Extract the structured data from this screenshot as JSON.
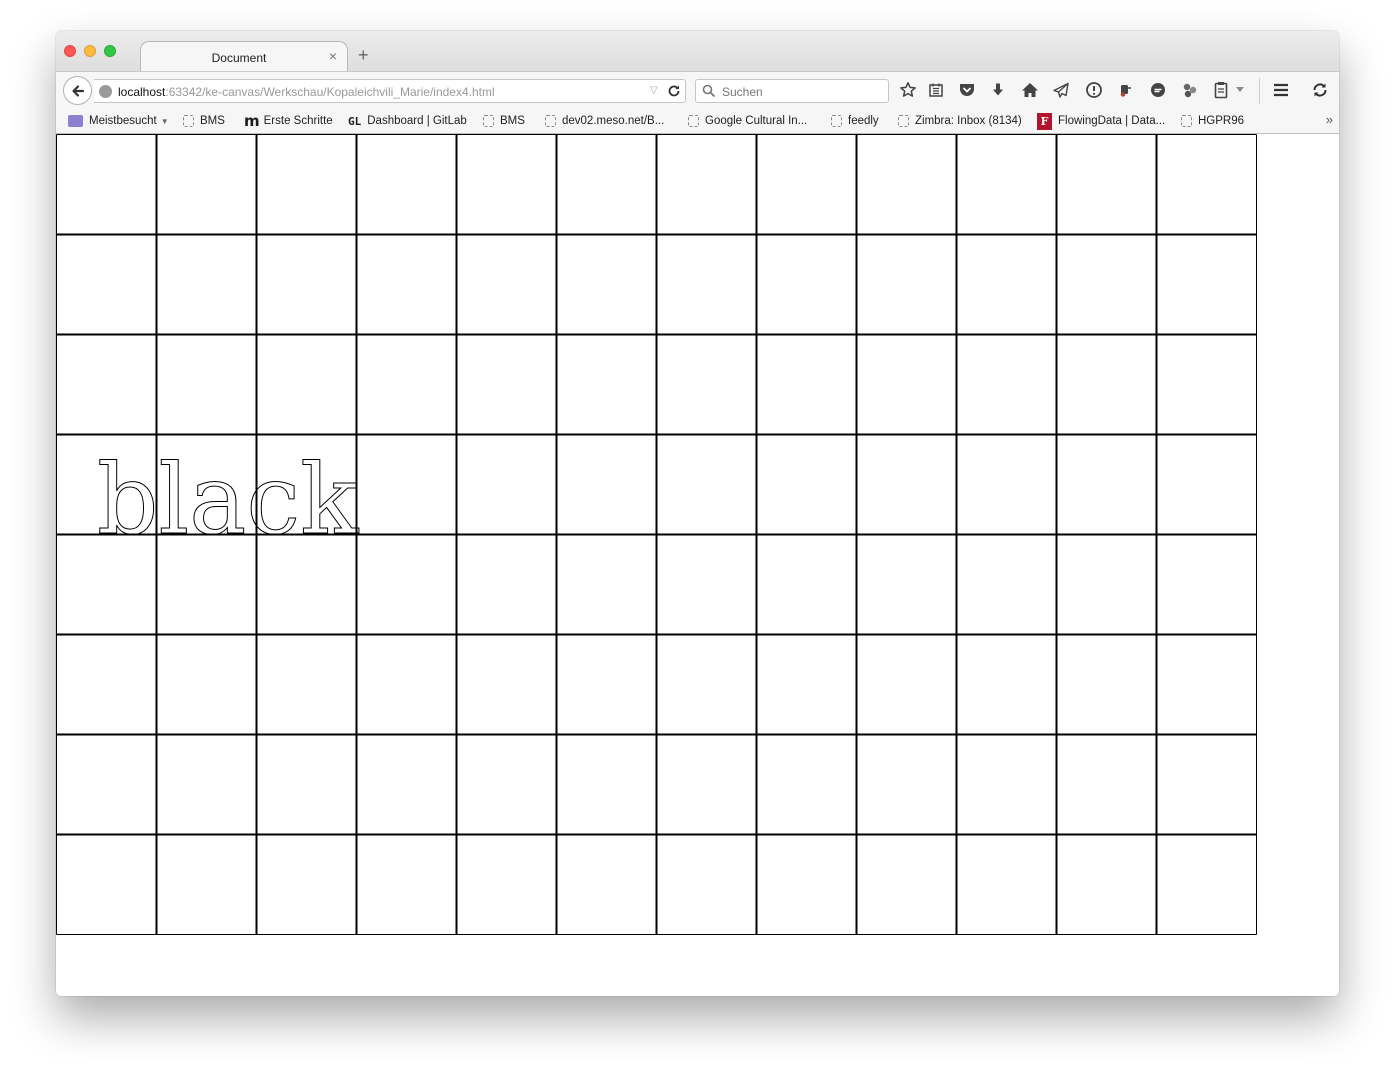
{
  "tab": {
    "title": "Document"
  },
  "url": {
    "host": "localhost",
    "rest": ":63342/ke-canvas/Werkschau/Kopaleichvili_Marie/index4.html"
  },
  "search": {
    "placeholder": "Suchen"
  },
  "bookmarks": [
    {
      "label": "Meistbesucht",
      "icon": "folder-icon"
    },
    {
      "label": "BMS",
      "icon": "page-icon"
    },
    {
      "label": "Erste Schritte",
      "icon": "m-logo-icon",
      "glyph": "m"
    },
    {
      "label": "Dashboard | GitLab",
      "icon": "gl-logo-icon",
      "glyph": "GL"
    },
    {
      "label": "BMS",
      "icon": "page-icon"
    },
    {
      "label": "dev02.meso.net/B...",
      "icon": "page-icon"
    },
    {
      "label": "Google Cultural In...",
      "icon": "page-icon"
    },
    {
      "label": "feedly",
      "icon": "page-icon"
    },
    {
      "label": "Zimbra: Inbox (8134)",
      "icon": "page-icon"
    },
    {
      "label": "FlowingData | Data...",
      "icon": "flowingdata-icon",
      "glyph": "F"
    },
    {
      "label": "HGPR96",
      "icon": "page-icon"
    }
  ],
  "canvas": {
    "text": "black",
    "grid_rows": 8,
    "grid_cols": 12,
    "line_color": "#000000"
  },
  "colors": {
    "close": "#fc5753",
    "minimize": "#fdbc40",
    "maximize": "#33c748",
    "folder": "#8f7fd1",
    "flowingdata": "#b0142e"
  }
}
